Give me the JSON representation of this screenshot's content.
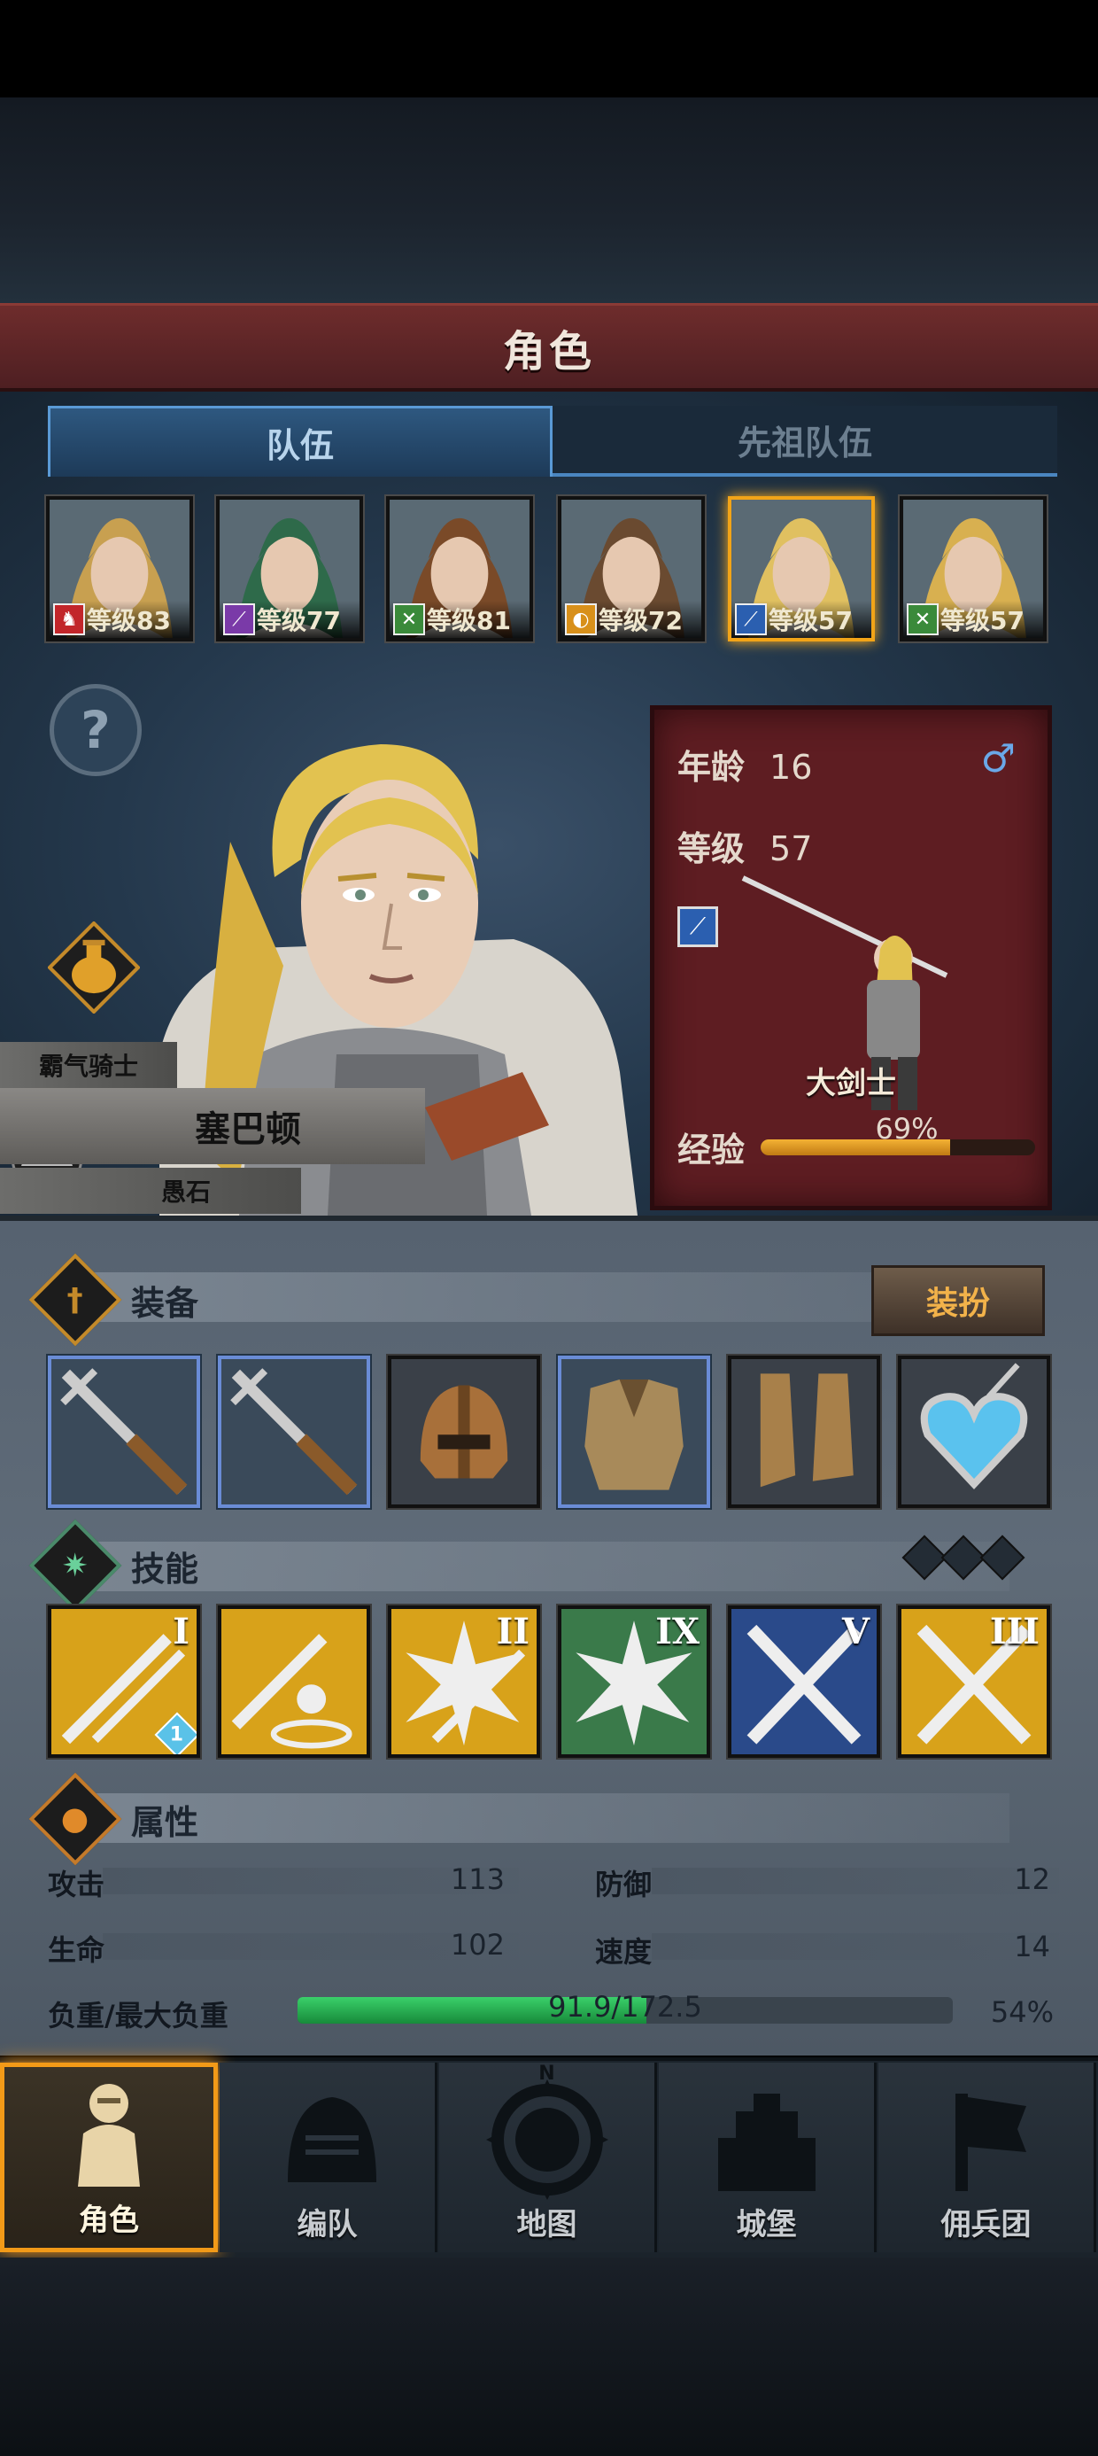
{
  "header": {
    "title": "角色"
  },
  "tabs": [
    {
      "label": "队伍",
      "active": true
    },
    {
      "label": "先祖队伍",
      "active": false
    }
  ],
  "party": [
    {
      "level_text": "等级83",
      "class_icon": "cavalry-icon",
      "class_color": "#c2262a",
      "hair": "#c8a050"
    },
    {
      "level_text": "等级77",
      "class_icon": "staff-icon",
      "class_color": "#7a3aa8",
      "hair": "#2e6a4a"
    },
    {
      "level_text": "等级81",
      "class_icon": "crossed-swords-icon",
      "class_color": "#3a8a3a",
      "hair": "#7a4a28"
    },
    {
      "level_text": "等级72",
      "class_icon": "shield-icon",
      "class_color": "#d8901a",
      "hair": "#6a4a30"
    },
    {
      "level_text": "等级57",
      "class_icon": "greatsword-icon",
      "class_color": "#2b5fb0",
      "hair": "#e0c060",
      "selected": true
    },
    {
      "level_text": "等级57",
      "class_icon": "crossed-swords-icon",
      "class_color": "#3a8a3a",
      "hair": "#d8b050"
    }
  ],
  "hero": {
    "trait": "霸气骑士",
    "name": "塞巴顿",
    "title": "愚石",
    "age_label": "年龄",
    "age": "16",
    "gender_symbol": "♂",
    "level_label": "等级",
    "level": "57",
    "class_name": "大剑士",
    "exp_label": "经验",
    "exp_text": "69%",
    "exp_fraction": 0.69
  },
  "equipment": {
    "label": "装备",
    "dress_button": "装扮",
    "slots": [
      {
        "name": "weapon-slot-1",
        "icon": "spear-icon",
        "highlight": true
      },
      {
        "name": "weapon-slot-2",
        "icon": "spear-icon",
        "highlight": true
      },
      {
        "name": "helmet-slot",
        "icon": "helmet-icon",
        "highlight": false
      },
      {
        "name": "armor-slot",
        "icon": "armor-icon",
        "highlight": true
      },
      {
        "name": "boots-slot",
        "icon": "boots-icon",
        "highlight": false
      },
      {
        "name": "amulet-slot",
        "icon": "heart-amulet-icon",
        "highlight": false
      }
    ]
  },
  "skills": {
    "label": "技能",
    "items": [
      {
        "numeral": "I",
        "bg": "#d8a21a",
        "icon": "sword-strike-icon",
        "badge": "1"
      },
      {
        "numeral": "",
        "bg": "#d8a21a",
        "icon": "sword-aura-icon"
      },
      {
        "numeral": "II",
        "bg": "#d8a21a",
        "icon": "burst-strike-icon"
      },
      {
        "numeral": "IX",
        "bg": "#3a7a4a",
        "icon": "burst-icon"
      },
      {
        "numeral": "V",
        "bg": "#2a4a8a",
        "icon": "crossed-blades-icon"
      },
      {
        "numeral": "III",
        "bg": "#d8a21a",
        "icon": "crossed-blades-icon"
      }
    ]
  },
  "attributes": {
    "label": "属性",
    "attack_label": "攻击",
    "attack": "113",
    "defense_label": "防御",
    "defense": "12",
    "hp_label": "生命",
    "hp": "102",
    "speed_label": "速度",
    "speed": "14",
    "load_label": "负重/最大负重",
    "load_text": "91.9/172.5",
    "load_percent": "54%",
    "load_fraction": 0.533
  },
  "nav": [
    {
      "label": "角色",
      "icon": "knight-icon",
      "active": true
    },
    {
      "label": "编队",
      "icon": "helmet-group-icon",
      "active": false
    },
    {
      "label": "地图",
      "icon": "compass-map-icon",
      "active": false,
      "compass_letter": "N"
    },
    {
      "label": "城堡",
      "icon": "castle-icon",
      "active": false
    },
    {
      "label": "佣兵团",
      "icon": "mercenary-banner-icon",
      "active": false
    }
  ]
}
